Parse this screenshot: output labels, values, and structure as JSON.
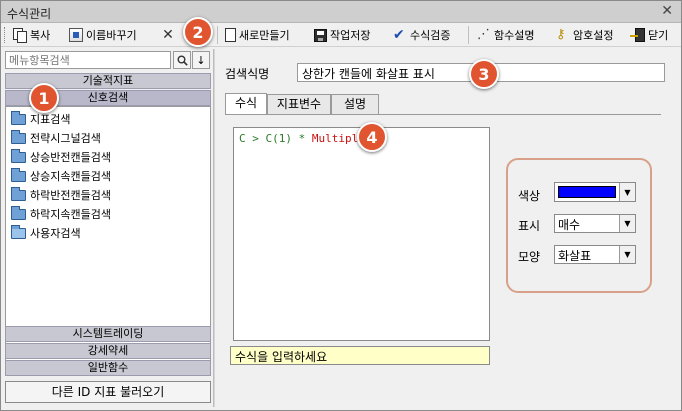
{
  "window": {
    "title": "수식관리",
    "close_glyph": "✕"
  },
  "toolbar": {
    "copy": "복사",
    "rename": "이름바꾸기",
    "new": "새로만들기",
    "save": "작업저장",
    "verify": "수식검증",
    "func_desc": "함수설명",
    "password": "암호설정",
    "close": "닫기"
  },
  "sidebar": {
    "search_placeholder": "메뉴항목검색",
    "search_btn": "🔍",
    "sort_btn": "↓",
    "categories_top": [
      "기술적지표",
      "신호검색"
    ],
    "tree_items": [
      "지표검색",
      "전략시그널검색",
      "상승반전캔들검색",
      "상승지속캔들검색",
      "하락반전캔들검색",
      "하락지속캔들검색",
      "사용자검색"
    ],
    "categories_bottom": [
      "시스템트레이딩",
      "강세약세",
      "일반함수"
    ],
    "load_button": "다른 ID 지표 불러오기"
  },
  "main": {
    "name_label": "검색식명",
    "name_value": "상한가 캔들에 화살표 표시",
    "tabs": [
      "수식",
      "지표변수",
      "설명"
    ],
    "formula": {
      "t1": "C > C(1) ",
      "t2": "* ",
      "t3": "Multiple"
    },
    "hint": "수식을 입력하세요"
  },
  "settings": {
    "color_label": "색상",
    "color_value": "#0000FF",
    "display_label": "표시",
    "display_value": "매수",
    "shape_label": "모양",
    "shape_value": "화살표"
  },
  "callouts": [
    "1",
    "2",
    "3",
    "4"
  ]
}
